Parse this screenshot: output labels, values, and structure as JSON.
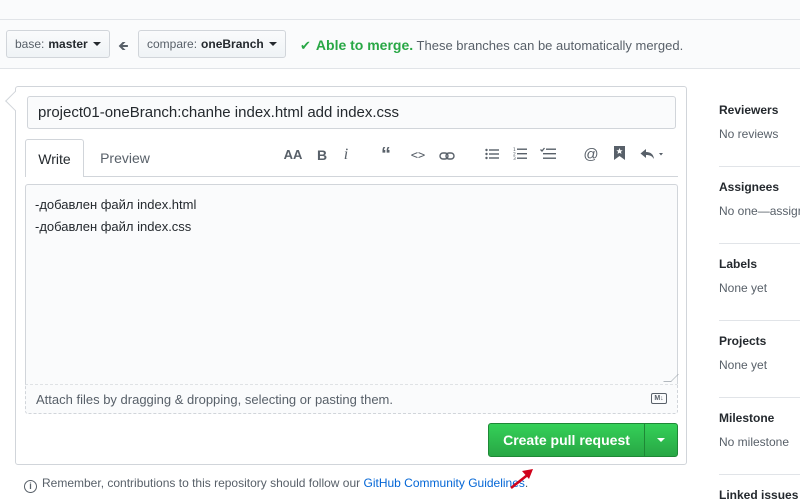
{
  "compare": {
    "base_prefix": "base:",
    "base_branch": "master",
    "compare_prefix": "compare:",
    "compare_branch": "oneBranch",
    "merge_ok": "Able to merge.",
    "merge_detail": "These branches can be automatically merged."
  },
  "form": {
    "title_value": "project01-oneBranch:chanhe index.html add index.css",
    "tabs": [
      "Write",
      "Preview"
    ],
    "toolbar_icons": [
      "header-icon",
      "bold-icon",
      "italic-icon",
      "quote-icon",
      "code-icon",
      "link-icon",
      "bullet-list-icon",
      "numbered-list-icon",
      "task-list-icon",
      "mention-icon",
      "saved-reply-icon",
      "reply-icon"
    ],
    "body_lines": [
      "-добавлен файл index.html",
      "-добавлен файл index.css"
    ],
    "attach_text": "Attach files by dragging & dropping, selecting or pasting them."
  },
  "actions": {
    "create_label": "Create pull request"
  },
  "notice": {
    "text": "Remember, contributions to this repository should follow our",
    "link": "GitHub Community Guidelines",
    "end": "."
  },
  "sidebar": {
    "sections": [
      {
        "title": "Reviewers",
        "value": "No reviews"
      },
      {
        "title": "Assignees",
        "value": "No one—assign yourself"
      },
      {
        "title": "Labels",
        "value": "None yet"
      },
      {
        "title": "Projects",
        "value": "None yet"
      },
      {
        "title": "Milestone",
        "value": "No milestone"
      },
      {
        "title": "Linked issues",
        "value": ""
      }
    ]
  },
  "colors": {
    "success": "#28a745",
    "link": "#0366d6",
    "annotation_arrow": "#d0021b"
  }
}
